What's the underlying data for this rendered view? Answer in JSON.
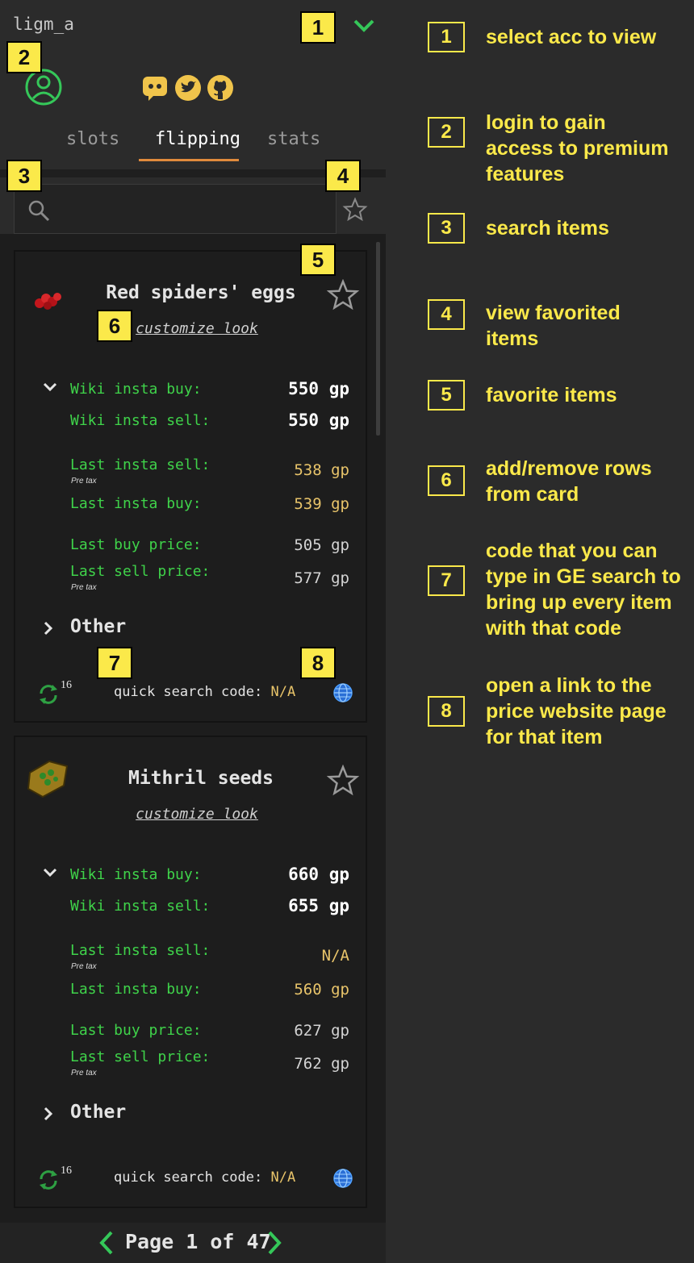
{
  "header": {
    "account_name": "ligm_a",
    "tabs": [
      "slots",
      "flipping",
      "stats"
    ],
    "active_tab": "flipping"
  },
  "colors": {
    "accent_tab_underline": "#e08a3c",
    "green_label": "#3fd34a",
    "yellow_value": "#e8c46a",
    "callout_yellow": "#fbe94a",
    "login_icon_green": "#35c759",
    "discord_twitter_github_icon": "#f0c44b"
  },
  "search": {
    "placeholder": "",
    "value": ""
  },
  "cards": [
    {
      "name": "Red spiders' eggs",
      "customize_label": "customize look",
      "rows": [
        {
          "label": "Wiki insta buy:",
          "sub": "",
          "value": "550 gp"
        },
        {
          "label": "Wiki insta sell:",
          "sub": "",
          "value": "550 gp"
        },
        {
          "label": "Last insta sell:",
          "sub": "Pre tax",
          "value": "538 gp"
        },
        {
          "label": "Last insta buy:",
          "sub": "",
          "value": "539 gp"
        },
        {
          "label": "Last buy price:",
          "sub": "",
          "value": "505 gp"
        },
        {
          "label": "Last sell price:",
          "sub": "Pre tax",
          "value": "577 gp"
        }
      ],
      "other_label": "Other",
      "refresh_count": "16",
      "quick_search_label": "quick search code:",
      "quick_search_code": "N/A"
    },
    {
      "name": "Mithril seeds",
      "customize_label": "customize look",
      "rows": [
        {
          "label": "Wiki insta buy:",
          "sub": "",
          "value": "660 gp"
        },
        {
          "label": "Wiki insta sell:",
          "sub": "",
          "value": "655 gp"
        },
        {
          "label": "Last insta sell:",
          "sub": "Pre tax",
          "value": "N/A"
        },
        {
          "label": "Last insta buy:",
          "sub": "",
          "value": "560 gp"
        },
        {
          "label": "Last buy price:",
          "sub": "",
          "value": "627 gp"
        },
        {
          "label": "Last sell price:",
          "sub": "Pre tax",
          "value": "762 gp"
        }
      ],
      "other_label": "Other",
      "refresh_count": "16",
      "quick_search_label": "quick search code:",
      "quick_search_code": "N/A"
    }
  ],
  "pagination": {
    "text": "Page 1 of 47"
  },
  "callouts": [
    "1",
    "2",
    "3",
    "4",
    "5",
    "6",
    "7",
    "8"
  ],
  "legend": [
    {
      "num": "1",
      "text": "select acc to view"
    },
    {
      "num": "2",
      "text": "login to gain\naccess to premium\nfeatures"
    },
    {
      "num": "3",
      "text": "search items"
    },
    {
      "num": "4",
      "text": "view favorited\nitems"
    },
    {
      "num": "5",
      "text": "favorite items"
    },
    {
      "num": "6",
      "text": "add/remove rows\nfrom card"
    },
    {
      "num": "7",
      "text": "code that you can\ntype in GE search to\nbring up every item\nwith that code"
    },
    {
      "num": "8",
      "text": "open a link to the\nprice website page\nfor that item"
    }
  ]
}
